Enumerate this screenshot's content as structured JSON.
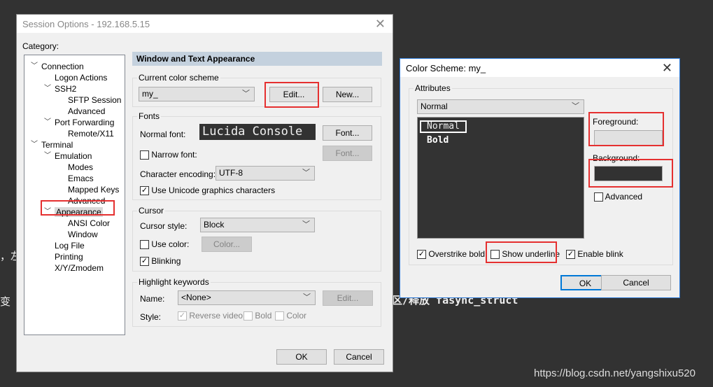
{
  "background": {
    "texts": [
      "，左",
      "变",
      "区/释放 fasync_struct"
    ],
    "watermark": "https://blog.csdn.net/yangshixu520"
  },
  "session": {
    "title": "Session Options - 192.168.5.15",
    "category_label": "Category:",
    "tree": [
      {
        "label": "Connection",
        "level": 0,
        "expanded": true
      },
      {
        "label": "Logon Actions",
        "level": 1
      },
      {
        "label": "SSH2",
        "level": 1,
        "expanded": true
      },
      {
        "label": "SFTP Session",
        "level": 2
      },
      {
        "label": "Advanced",
        "level": 2
      },
      {
        "label": "Port Forwarding",
        "level": 1,
        "expanded": true
      },
      {
        "label": "Remote/X11",
        "level": 2
      },
      {
        "label": "Terminal",
        "level": 0,
        "expanded": true
      },
      {
        "label": "Emulation",
        "level": 1,
        "expanded": true
      },
      {
        "label": "Modes",
        "level": 2
      },
      {
        "label": "Emacs",
        "level": 2
      },
      {
        "label": "Mapped Keys",
        "level": 2
      },
      {
        "label": "Advanced",
        "level": 2
      },
      {
        "label": "Appearance",
        "level": 1,
        "expanded": true,
        "selected": true
      },
      {
        "label": "ANSI Color",
        "level": 2
      },
      {
        "label": "Window",
        "level": 2
      },
      {
        "label": "Log File",
        "level": 1
      },
      {
        "label": "Printing",
        "level": 1
      },
      {
        "label": "X/Y/Zmodem",
        "level": 1
      }
    ],
    "section_title": "Window and Text Appearance",
    "color_scheme": {
      "label": "Current color scheme",
      "value": "my_",
      "edit": "Edit...",
      "new": "New..."
    },
    "fonts": {
      "label": "Fonts",
      "normal_font_label": "Normal font:",
      "normal_font_preview": "Lucida Console",
      "font_btn": "Font...",
      "narrow_font_label": "Narrow font:",
      "narrow_font_checked": false,
      "narrow_font_btn": "Font...",
      "encoding_label": "Character encoding:",
      "encoding_value": "UTF-8",
      "unicode_label": "Use Unicode graphics characters",
      "unicode_checked": true
    },
    "cursor": {
      "label": "Cursor",
      "style_label": "Cursor style:",
      "style_value": "Block",
      "use_color_label": "Use color:",
      "use_color_checked": false,
      "color_btn": "Color...",
      "blinking_label": "Blinking",
      "blinking_checked": true
    },
    "highlight": {
      "label": "Highlight keywords",
      "name_label": "Name:",
      "name_value": "<None>",
      "edit_btn": "Edit...",
      "style_label": "Style:",
      "reverse_video": "Reverse video",
      "bold": "Bold",
      "color": "Color"
    },
    "ok": "OK",
    "cancel": "Cancel"
  },
  "scheme": {
    "title": "Color Scheme: my_",
    "attributes_label": "Attributes",
    "attribute_value": "Normal",
    "preview": [
      "Normal",
      "Bold"
    ],
    "foreground_label": "Foreground:",
    "foreground_color": "#f0f0f0",
    "background_label": "Background:",
    "background_color": "#323232",
    "advanced_label": "Advanced",
    "overstrike_bold": "Overstrike bold",
    "show_underline": "Show underline",
    "enable_blink": "Enable blink",
    "ok": "OK",
    "cancel": "Cancel"
  }
}
